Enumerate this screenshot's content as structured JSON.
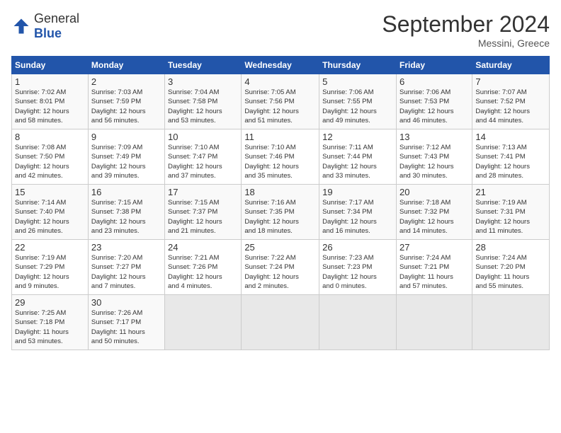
{
  "logo": {
    "general": "General",
    "blue": "Blue"
  },
  "title": "September 2024",
  "location": "Messini, Greece",
  "headers": [
    "Sunday",
    "Monday",
    "Tuesday",
    "Wednesday",
    "Thursday",
    "Friday",
    "Saturday"
  ],
  "weeks": [
    [
      {
        "day": "1",
        "detail": "Sunrise: 7:02 AM\nSunset: 8:01 PM\nDaylight: 12 hours\nand 58 minutes."
      },
      {
        "day": "2",
        "detail": "Sunrise: 7:03 AM\nSunset: 7:59 PM\nDaylight: 12 hours\nand 56 minutes."
      },
      {
        "day": "3",
        "detail": "Sunrise: 7:04 AM\nSunset: 7:58 PM\nDaylight: 12 hours\nand 53 minutes."
      },
      {
        "day": "4",
        "detail": "Sunrise: 7:05 AM\nSunset: 7:56 PM\nDaylight: 12 hours\nand 51 minutes."
      },
      {
        "day": "5",
        "detail": "Sunrise: 7:06 AM\nSunset: 7:55 PM\nDaylight: 12 hours\nand 49 minutes."
      },
      {
        "day": "6",
        "detail": "Sunrise: 7:06 AM\nSunset: 7:53 PM\nDaylight: 12 hours\nand 46 minutes."
      },
      {
        "day": "7",
        "detail": "Sunrise: 7:07 AM\nSunset: 7:52 PM\nDaylight: 12 hours\nand 44 minutes."
      }
    ],
    [
      {
        "day": "8",
        "detail": "Sunrise: 7:08 AM\nSunset: 7:50 PM\nDaylight: 12 hours\nand 42 minutes."
      },
      {
        "day": "9",
        "detail": "Sunrise: 7:09 AM\nSunset: 7:49 PM\nDaylight: 12 hours\nand 39 minutes."
      },
      {
        "day": "10",
        "detail": "Sunrise: 7:10 AM\nSunset: 7:47 PM\nDaylight: 12 hours\nand 37 minutes."
      },
      {
        "day": "11",
        "detail": "Sunrise: 7:10 AM\nSunset: 7:46 PM\nDaylight: 12 hours\nand 35 minutes."
      },
      {
        "day": "12",
        "detail": "Sunrise: 7:11 AM\nSunset: 7:44 PM\nDaylight: 12 hours\nand 33 minutes."
      },
      {
        "day": "13",
        "detail": "Sunrise: 7:12 AM\nSunset: 7:43 PM\nDaylight: 12 hours\nand 30 minutes."
      },
      {
        "day": "14",
        "detail": "Sunrise: 7:13 AM\nSunset: 7:41 PM\nDaylight: 12 hours\nand 28 minutes."
      }
    ],
    [
      {
        "day": "15",
        "detail": "Sunrise: 7:14 AM\nSunset: 7:40 PM\nDaylight: 12 hours\nand 26 minutes."
      },
      {
        "day": "16",
        "detail": "Sunrise: 7:15 AM\nSunset: 7:38 PM\nDaylight: 12 hours\nand 23 minutes."
      },
      {
        "day": "17",
        "detail": "Sunrise: 7:15 AM\nSunset: 7:37 PM\nDaylight: 12 hours\nand 21 minutes."
      },
      {
        "day": "18",
        "detail": "Sunrise: 7:16 AM\nSunset: 7:35 PM\nDaylight: 12 hours\nand 18 minutes."
      },
      {
        "day": "19",
        "detail": "Sunrise: 7:17 AM\nSunset: 7:34 PM\nDaylight: 12 hours\nand 16 minutes."
      },
      {
        "day": "20",
        "detail": "Sunrise: 7:18 AM\nSunset: 7:32 PM\nDaylight: 12 hours\nand 14 minutes."
      },
      {
        "day": "21",
        "detail": "Sunrise: 7:19 AM\nSunset: 7:31 PM\nDaylight: 12 hours\nand 11 minutes."
      }
    ],
    [
      {
        "day": "22",
        "detail": "Sunrise: 7:19 AM\nSunset: 7:29 PM\nDaylight: 12 hours\nand 9 minutes."
      },
      {
        "day": "23",
        "detail": "Sunrise: 7:20 AM\nSunset: 7:27 PM\nDaylight: 12 hours\nand 7 minutes."
      },
      {
        "day": "24",
        "detail": "Sunrise: 7:21 AM\nSunset: 7:26 PM\nDaylight: 12 hours\nand 4 minutes."
      },
      {
        "day": "25",
        "detail": "Sunrise: 7:22 AM\nSunset: 7:24 PM\nDaylight: 12 hours\nand 2 minutes."
      },
      {
        "day": "26",
        "detail": "Sunrise: 7:23 AM\nSunset: 7:23 PM\nDaylight: 12 hours\nand 0 minutes."
      },
      {
        "day": "27",
        "detail": "Sunrise: 7:24 AM\nSunset: 7:21 PM\nDaylight: 11 hours\nand 57 minutes."
      },
      {
        "day": "28",
        "detail": "Sunrise: 7:24 AM\nSunset: 7:20 PM\nDaylight: 11 hours\nand 55 minutes."
      }
    ],
    [
      {
        "day": "29",
        "detail": "Sunrise: 7:25 AM\nSunset: 7:18 PM\nDaylight: 11 hours\nand 53 minutes."
      },
      {
        "day": "30",
        "detail": "Sunrise: 7:26 AM\nSunset: 7:17 PM\nDaylight: 11 hours\nand 50 minutes."
      },
      {
        "day": "",
        "detail": ""
      },
      {
        "day": "",
        "detail": ""
      },
      {
        "day": "",
        "detail": ""
      },
      {
        "day": "",
        "detail": ""
      },
      {
        "day": "",
        "detail": ""
      }
    ]
  ]
}
